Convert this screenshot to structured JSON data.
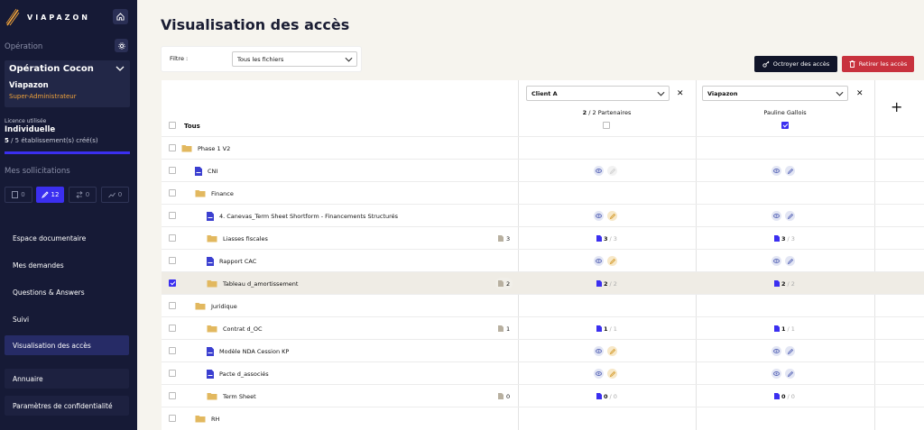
{
  "brand": {
    "name": "VIAPAZON"
  },
  "sidebar": {
    "operation_label": "Opération",
    "operation_name": "Opération Cocon",
    "client": "Viapazon",
    "role": "Super-Administrateur",
    "licence_label": "Licence utilisée",
    "licence_value": "Individuelle",
    "licence_used": "5",
    "licence_rest": " / 5 établissement(s) créé(s)",
    "licence_progress": 1.0,
    "sollicitations_label": "Mes sollicitations",
    "sollicitations": [
      {
        "icon": "document-icon",
        "count": "0"
      },
      {
        "icon": "pencil-icon",
        "count": "12"
      },
      {
        "icon": "arrows-icon",
        "count": "0"
      },
      {
        "icon": "chart-icon",
        "count": "0"
      }
    ],
    "nav": [
      "Espace documentaire",
      "Mes demandes",
      "Questions & Answers",
      "Suivi",
      "Visualisation des accès",
      "Annuaire",
      "Paramètres de confidentialité"
    ]
  },
  "page": {
    "title": "Visualisation des accès",
    "filter_label": "Filtre :",
    "filter_value": "Tous les fichiers",
    "grant_button": "Octroyer des accès",
    "revoke_button": "Retirer les accès"
  },
  "table": {
    "all_label": "Tous",
    "columns": [
      {
        "select": "Client A",
        "sub_bold": "2",
        "sub_rest": " / 2 Partenaires"
      },
      {
        "select": "Viapazon",
        "sub_bold": "",
        "sub_rest": "Pauline Gallois"
      }
    ],
    "add_column": "+",
    "rows": [
      {
        "label": "Phase 1 V2",
        "count": ""
      },
      {
        "label": "CNI",
        "count": ""
      },
      {
        "label": "Finance",
        "count": ""
      },
      {
        "label": "4. Canevas_Term Sheet Shortform - Financements Structurés",
        "count": ""
      },
      {
        "label": "Liasses fiscales",
        "count": "3",
        "a1": "3",
        "a1b": "3",
        "a2": "3",
        "a2b": "3"
      },
      {
        "label": "Rapport CAC",
        "count": ""
      },
      {
        "label": "Tableau d_amortissement",
        "count": "2",
        "a1": "2",
        "a1b": "2",
        "a2": "2",
        "a2b": "2"
      },
      {
        "label": "Juridique",
        "count": ""
      },
      {
        "label": "Contrat d_OC",
        "count": "1",
        "a1": "1",
        "a1b": "1",
        "a2": "1",
        "a2b": "1"
      },
      {
        "label": "Modèle NDA Cession KP",
        "count": ""
      },
      {
        "label": "Pacte d_associés",
        "count": ""
      },
      {
        "label": "Term Sheet",
        "count": "0",
        "a1": "0",
        "a1b": "0",
        "a2": "0",
        "a2b": "0"
      },
      {
        "label": "RH",
        "count": ""
      }
    ],
    "sep": " / "
  },
  "colors": {
    "sidebar": "#161a36",
    "accent": "#3b2ff0",
    "danger": "#c8323e",
    "folder": "#e2b85f",
    "file": "#3b3fd0"
  }
}
